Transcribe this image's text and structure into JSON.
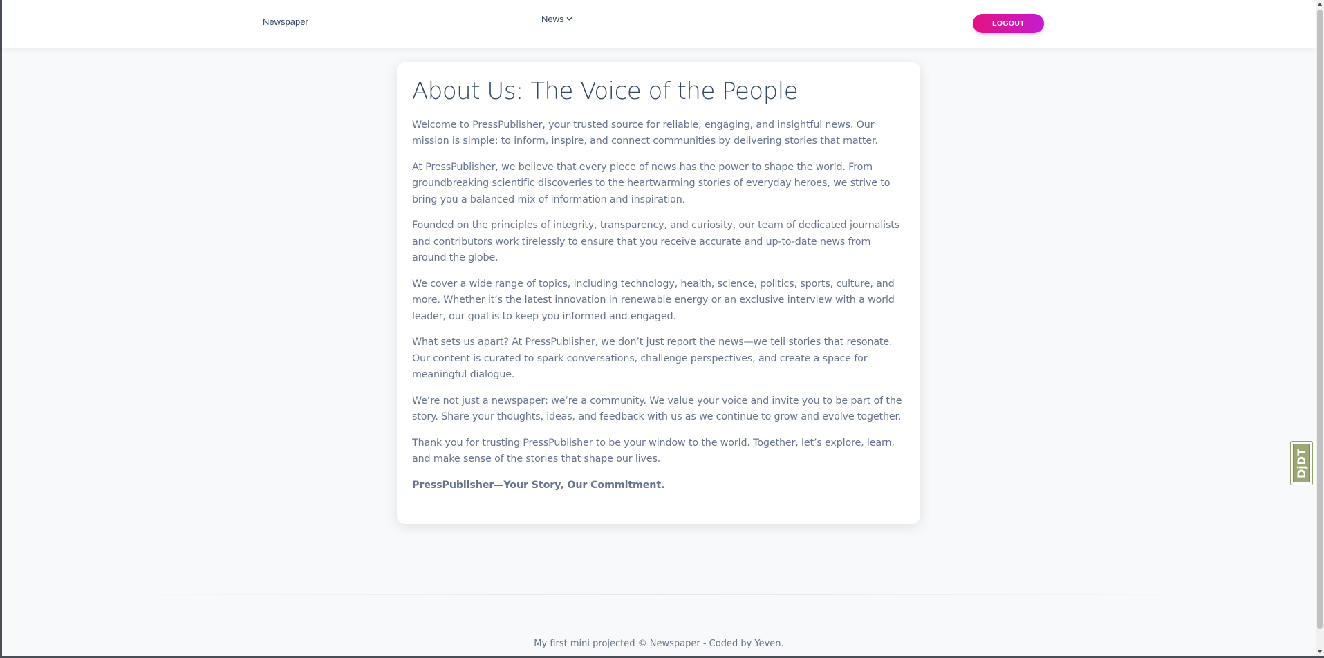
{
  "navbar": {
    "brand": "Newspaper",
    "news_menu": "News",
    "logout_label": "LOGOUT"
  },
  "about": {
    "title": "About Us: The Voice of the People",
    "paragraphs": [
      "Welcome to PressPublisher, your trusted source for reliable, engaging, and insightful news. Our mission is simple: to inform, inspire, and connect communities by delivering stories that matter.",
      "At PressPublisher, we believe that every piece of news has the power to shape the world. From groundbreaking scientific discoveries to the heartwarming stories of everyday heroes, we strive to bring you a balanced mix of information and inspiration.",
      "Founded on the principles of integrity, transparency, and curiosity, our team of dedicated journalists and contributors work tirelessly to ensure that you receive accurate and up-to-date news from around the globe.",
      "We cover a wide range of topics, including technology, health, science, politics, sports, culture, and more. Whether it’s the latest innovation in renewable energy or an exclusive interview with a world leader, our goal is to keep you informed and engaged.",
      "What sets us apart? At PressPublisher, we don’t just report the news—we tell stories that resonate. Our content is curated to spark conversations, challenge perspectives, and create a space for meaningful dialogue.",
      "We’re not just a newspaper; we’re a community. We value your voice and invite you to be part of the story. Share your thoughts, ideas, and feedback with us as we continue to grow and evolve together.",
      "Thank you for trusting PressPublisher to be your window to the world. Together, let’s explore, learn, and make sense of the stories that shape our lives."
    ],
    "tagline": "PressPublisher—Your Story, Our Commitment."
  },
  "footer": {
    "text": "My first mini projected © Newspaper - Coded by Yeven."
  },
  "widget": {
    "label": "DjDT"
  },
  "colors": {
    "heading": "#344767",
    "body_text": "#67748e",
    "logout_gradient_start": "#e3137f",
    "logout_gradient_end": "#c41ccf",
    "page_background": "#f8f9fa",
    "widget_green": "#9aa876"
  },
  "icons": {
    "news_menu_icon": "chevron-down-icon"
  }
}
